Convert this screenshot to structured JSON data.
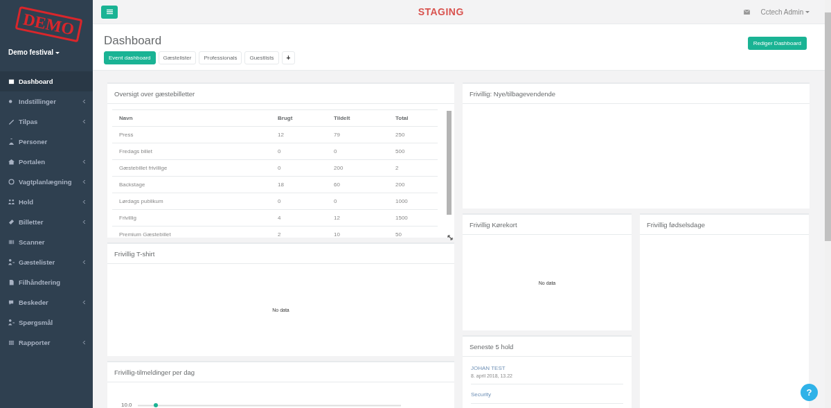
{
  "sidebar": {
    "logo_stamp": "DEMO",
    "event_menu": "Demo festival",
    "items": [
      {
        "label": "Dashboard",
        "selected": true,
        "expandable": false
      },
      {
        "label": "Indstillinger",
        "selected": false,
        "expandable": true
      },
      {
        "label": "Tilpas",
        "selected": false,
        "expandable": true
      },
      {
        "label": "Personer",
        "selected": false,
        "expandable": false
      },
      {
        "label": "Portalen",
        "selected": false,
        "expandable": true
      },
      {
        "label": "Vagtplanlægning",
        "selected": false,
        "expandable": true
      },
      {
        "label": "Hold",
        "selected": false,
        "expandable": true
      },
      {
        "label": "Billetter",
        "selected": false,
        "expandable": true
      },
      {
        "label": "Scanner",
        "selected": false,
        "expandable": false
      },
      {
        "label": "Gæstelister",
        "selected": false,
        "expandable": true
      },
      {
        "label": "Filhåndtering",
        "selected": false,
        "expandable": false
      },
      {
        "label": "Beskeder",
        "selected": false,
        "expandable": true
      },
      {
        "label": "Spørgsmål",
        "selected": false,
        "expandable": false
      },
      {
        "label": "Rapporter",
        "selected": false,
        "expandable": true
      }
    ]
  },
  "topbar": {
    "environment": "STAGING",
    "user": "Cctech Admin"
  },
  "header": {
    "title": "Dashboard",
    "edit_button": "Rediger Dashboard",
    "tabs": [
      {
        "label": "Event dashboard",
        "selected": true
      },
      {
        "label": "Gæstelister",
        "selected": false
      },
      {
        "label": "Professionals",
        "selected": false
      },
      {
        "label": "Guestlists",
        "selected": false
      }
    ],
    "add_tab": "+"
  },
  "guest_tickets": {
    "title": "Oversigt over gæstebilletter",
    "columns": [
      "Navn",
      "Brugt",
      "Tildelt",
      "Total"
    ],
    "rows": [
      [
        "Press",
        "12",
        "79",
        "250"
      ],
      [
        "Fredags billet",
        "0",
        "0",
        "500"
      ],
      [
        "Gæstebillet frivillige",
        "0",
        "200",
        "2"
      ],
      [
        "Backstage",
        "18",
        "60",
        "200"
      ],
      [
        "Lørdags publikum",
        "0",
        "0",
        "1000"
      ],
      [
        "Frivillig",
        "4",
        "12",
        "1500"
      ],
      [
        "Premium Gæstebillet",
        "2",
        "10",
        "50"
      ]
    ]
  },
  "tshirt": {
    "title": "Frivillig T-shirt",
    "empty": "No data"
  },
  "signups": {
    "title": "Frivillig-tilmeldinger per dag",
    "y_tick": "10.0"
  },
  "new_returning": {
    "title": "Frivillig: Nye/tilbagevendende"
  },
  "license": {
    "title": "Frivillig Kørekort",
    "empty": "No data"
  },
  "birthdays": {
    "title": "Frivillig fødselsdage"
  },
  "latest_teams": {
    "title": "Seneste 5 hold",
    "items": [
      {
        "name": "JOHAN TEST",
        "date": "8. april 2018, 13.22"
      },
      {
        "name": "Security"
      }
    ]
  },
  "help_button": "?"
}
